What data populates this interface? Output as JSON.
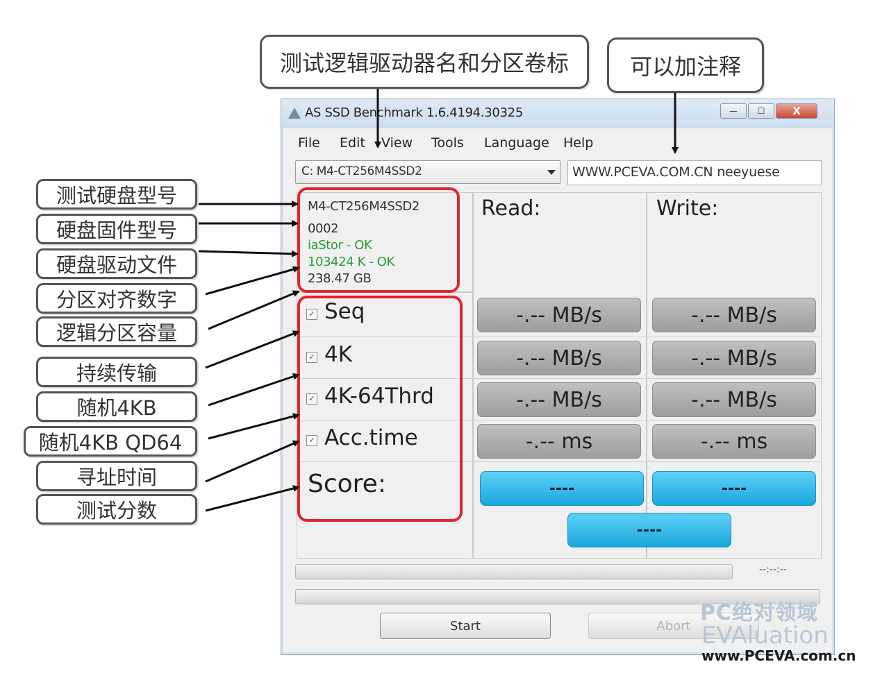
{
  "callouts": {
    "drive_label": "测试逻辑驱动器名和分区卷标",
    "comment_label": "可以加注释",
    "left": [
      "测试硬盘型号",
      "硬盘固件型号",
      "硬盘驱动文件",
      "分区对齐数字",
      "逻辑分区容量",
      "持续传输",
      "随机4KB",
      "随机4KB QD64",
      "寻址时间",
      "测试分数"
    ]
  },
  "window": {
    "title": "AS SSD Benchmark 1.6.4194.30325",
    "minimize": "—",
    "maximize": "☐",
    "close": "X"
  },
  "menu": [
    "File",
    "Edit",
    "View",
    "Tools",
    "Language",
    "Help"
  ],
  "drive_select": {
    "value": "C: M4-CT256M4SSD2"
  },
  "comment": {
    "value": "WWW.PCEVA.COM.CN  neeyuese"
  },
  "drive_info": {
    "model": "M4-CT256M4SSD2",
    "firmware": "0002",
    "driver": "iaStor - OK",
    "alignment": "103424 K - OK",
    "capacity": "238.47 GB"
  },
  "columns": {
    "read": "Read:",
    "write": "Write:"
  },
  "tests": [
    {
      "label": "Seq",
      "checked": true,
      "read": "-.-- MB/s",
      "write": "-.-- MB/s"
    },
    {
      "label": "4K",
      "checked": true,
      "read": "-.-- MB/s",
      "write": "-.-- MB/s"
    },
    {
      "label": "4K-64Thrd",
      "checked": true,
      "read": "-.-- MB/s",
      "write": "-.-- MB/s"
    },
    {
      "label": "Acc.time",
      "checked": true,
      "read": "-.-- ms",
      "write": "-.-- ms"
    }
  ],
  "score": {
    "label": "Score:",
    "read": "----",
    "write": "----",
    "total": "----"
  },
  "progress": {
    "time": "--:--:--"
  },
  "buttons": {
    "start": "Start",
    "abort": "Abort"
  },
  "watermark": {
    "line1": "PC绝对领域",
    "line2": "EVAluation",
    "line3": "www.PCEVA.com.cn"
  },
  "colors": {
    "accent_red": "#e0262c",
    "score_blue": "#18a7dc",
    "ok_green": "#2b9a3a"
  }
}
